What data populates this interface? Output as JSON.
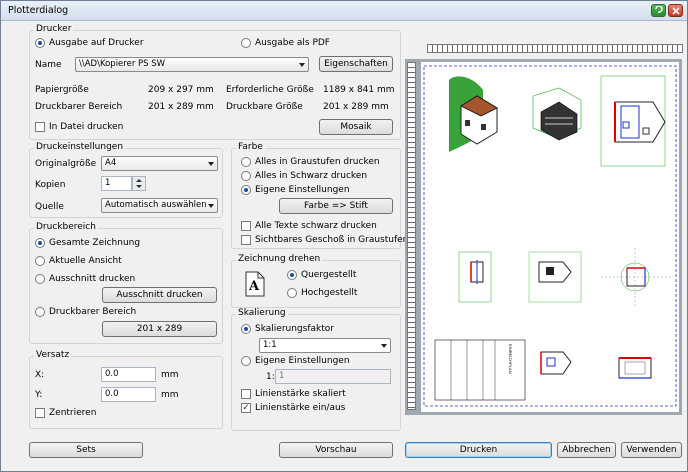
{
  "window": {
    "title": "Plotterdialog"
  },
  "drucker": {
    "label": "Drucker",
    "out_printer": "Ausgabe auf Drucker",
    "out_pdf": "Ausgabe als PDF",
    "name_label": "Name",
    "name_value": "\\\\AD\\Kopierer PS SW",
    "properties_btn": "Eigenschaften",
    "paper_size_label": "Papiergröße",
    "paper_size_value": "209 x 297 mm",
    "required_size_label": "Erforderliche Größe",
    "required_size_value": "1189 x 841 mm",
    "printable_area_label": "Druckbarer Bereich",
    "printable_area_value": "201 x 289 mm",
    "printable_size_label": "Druckbare Größe",
    "printable_size_value": "201 x 289 mm",
    "print_to_file": "In Datei drucken",
    "mosaik_btn": "Mosaik"
  },
  "druckeinstellungen": {
    "label": "Druckeinstellungen",
    "original_label": "Originalgröße",
    "original_value": "A4",
    "copies_label": "Kopien",
    "copies_value": "1",
    "source_label": "Quelle",
    "source_value": "Automatisch auswählen"
  },
  "farbe": {
    "label": "Farbe",
    "gray": "Alles in Graustufen drucken",
    "black": "Alles in Schwarz drucken",
    "custom": "Eigene Einstellungen",
    "color_btn": "Farbe => Stift",
    "texts_black": "Alle Texte schwarz drucken",
    "visible_floor_gray": "Sichtbares Geschoß in Graustufen"
  },
  "druckbereich": {
    "label": "Druckbereich",
    "whole": "Gesamte Zeichnung",
    "current": "Aktuelle Ansicht",
    "section": "Ausschnitt drucken",
    "section_btn": "Ausschnitt drucken",
    "printable": "Druckbarer Bereich",
    "printable_btn": "201 x 289"
  },
  "drehen": {
    "label": "Zeichnung drehen",
    "landscape": "Quergestellt",
    "portrait": "Hochgestellt",
    "icon_letter": "A"
  },
  "versatz": {
    "label": "Versatz",
    "x_label": "X:",
    "x_value": "0.0",
    "y_label": "Y:",
    "y_value": "0.0",
    "unit": "mm",
    "center": "Zentrieren"
  },
  "skalierung": {
    "label": "Skalierung",
    "factor": "Skalierungsfaktor",
    "factor_value": "1:1",
    "custom": "Eigene Einstellungen",
    "ratio_prefix": "1:",
    "ratio_value": "1",
    "line_scaled": "Linienstärke skaliert",
    "line_onoff": "Linienstärke ein/aus"
  },
  "footer": {
    "sets": "Sets",
    "preview": "Vorschau",
    "print": "Drucken",
    "cancel": "Abbrechen",
    "apply": "Verwenden"
  },
  "preview_sheet": {
    "stamp_text": "EINREICHPLAN"
  }
}
